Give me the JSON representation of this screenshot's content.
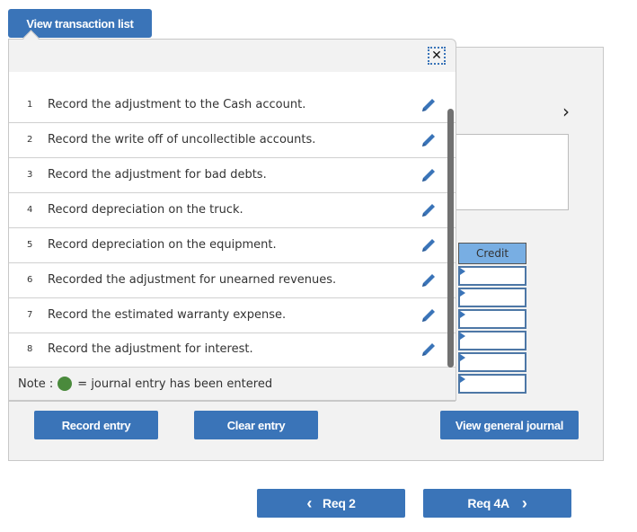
{
  "header": {
    "view_transaction_list_label": "View transaction list"
  },
  "popup": {
    "close_label": "✕",
    "transactions": [
      {
        "number": "1",
        "text": "Record the adjustment to the Cash account."
      },
      {
        "number": "2",
        "text": "Record the write off of uncollectible accounts."
      },
      {
        "number": "3",
        "text": "Record the adjustment for bad debts."
      },
      {
        "number": "4",
        "text": "Record depreciation on the truck."
      },
      {
        "number": "5",
        "text": "Record depreciation on the equipment."
      },
      {
        "number": "6",
        "text": "Recorded the adjustment for unearned revenues."
      },
      {
        "number": "7",
        "text": "Record the estimated warranty expense."
      },
      {
        "number": "8",
        "text": "Record the adjustment for interest."
      }
    ],
    "note_prefix": "Note :",
    "note_suffix": "= journal entry has been entered"
  },
  "journal": {
    "next_arrow": "›",
    "credit_header": "Credit",
    "credit_values": [
      "",
      "",
      "",
      "",
      "",
      ""
    ]
  },
  "actions": {
    "record_entry": "Record entry",
    "clear_entry": "Clear entry",
    "view_general_journal": "View general journal"
  },
  "navigation": {
    "prev_label": "Req 2",
    "next_label": "Req 4A",
    "prev_icon": "‹",
    "next_icon": "›"
  },
  "colors": {
    "accent": "#3a74b8",
    "entered_dot": "#4a8a3c",
    "credit_header": "#78aee3"
  }
}
